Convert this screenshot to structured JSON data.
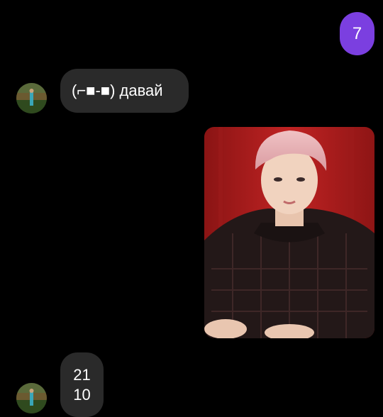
{
  "messages": {
    "outgoing_1": {
      "text": "7"
    },
    "incoming_1": {
      "text": "(⌐■-■) давай"
    },
    "photo": {
      "description_icon": "portrait-photo"
    },
    "incoming_2": {
      "line1": "21",
      "line2": "10"
    }
  },
  "colors": {
    "outgoing_bubble": "#7b3fe0",
    "incoming_bubble": "#2a2a2a",
    "background": "#000000"
  }
}
